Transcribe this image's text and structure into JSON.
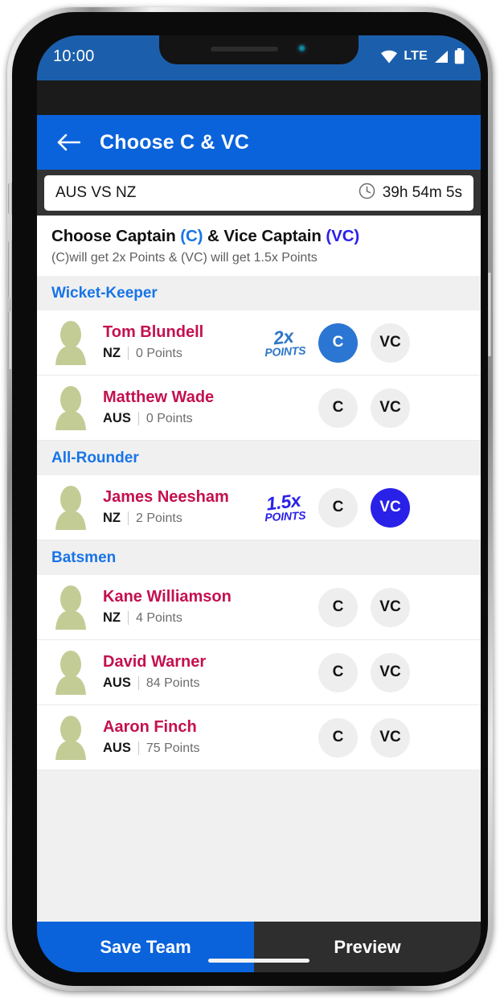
{
  "status_bar": {
    "time": "10:00",
    "network_label": "LTE",
    "icons": [
      "wifi-icon",
      "cellular-signal-icon",
      "battery-icon"
    ]
  },
  "app_bar": {
    "back_icon": "back-arrow-icon",
    "title": "Choose C & VC"
  },
  "match_bar": {
    "match": "AUS VS NZ",
    "clock_icon": "clock-icon",
    "time_remaining": "39h 54m 5s"
  },
  "instructions": {
    "title_part1": "Choose Captain ",
    "title_c": "(C)",
    "title_part2": " & Vice Captain ",
    "title_vc": "(VC)",
    "subtitle": "(C)will get 2x Points & (VC) will get 1.5x Points"
  },
  "colors": {
    "app_bar_blue": "#0a63db",
    "status_bar_blue": "#1b5fac",
    "captain_blue": "#2b76d2",
    "vice_captain_blue": "#2a21e8",
    "section_header_blue": "#1874e8",
    "player_name_crimson": "#c4104f",
    "avatar_green": "#c3cc95",
    "unselected_gray": "#eeeeee",
    "preview_dark": "#2e2e2e"
  },
  "pick_labels": {
    "captain": "C",
    "vice_captain": "VC"
  },
  "sections": [
    {
      "title": "Wicket-Keeper",
      "players": [
        {
          "name": "Tom Blundell",
          "team": "NZ",
          "points": "0 Points",
          "badge_top": "2x",
          "badge_bottom": "POINTS",
          "badge_kind": "2x",
          "c_selected": true,
          "vc_selected": false
        },
        {
          "name": "Matthew Wade",
          "team": "AUS",
          "points": "0 Points",
          "badge_top": "",
          "badge_bottom": "",
          "badge_kind": "none",
          "c_selected": false,
          "vc_selected": false
        }
      ]
    },
    {
      "title": "All-Rounder",
      "players": [
        {
          "name": "James Neesham",
          "team": "NZ",
          "points": "2 Points",
          "badge_top": "1.5x",
          "badge_bottom": "POINTS",
          "badge_kind": "1.5x",
          "c_selected": false,
          "vc_selected": true
        }
      ]
    },
    {
      "title": "Batsmen",
      "players": [
        {
          "name": "Kane Williamson",
          "team": "NZ",
          "points": "4 Points",
          "badge_top": "",
          "badge_bottom": "",
          "badge_kind": "none",
          "c_selected": false,
          "vc_selected": false
        },
        {
          "name": "David Warner",
          "team": "AUS",
          "points": "84 Points",
          "badge_top": "",
          "badge_bottom": "",
          "badge_kind": "none",
          "c_selected": false,
          "vc_selected": false
        },
        {
          "name": "Aaron Finch",
          "team": "AUS",
          "points": "75 Points",
          "badge_top": "",
          "badge_bottom": "",
          "badge_kind": "none",
          "c_selected": false,
          "vc_selected": false
        }
      ]
    }
  ],
  "bottom_bar": {
    "save_label": "Save Team",
    "preview_label": "Preview"
  }
}
